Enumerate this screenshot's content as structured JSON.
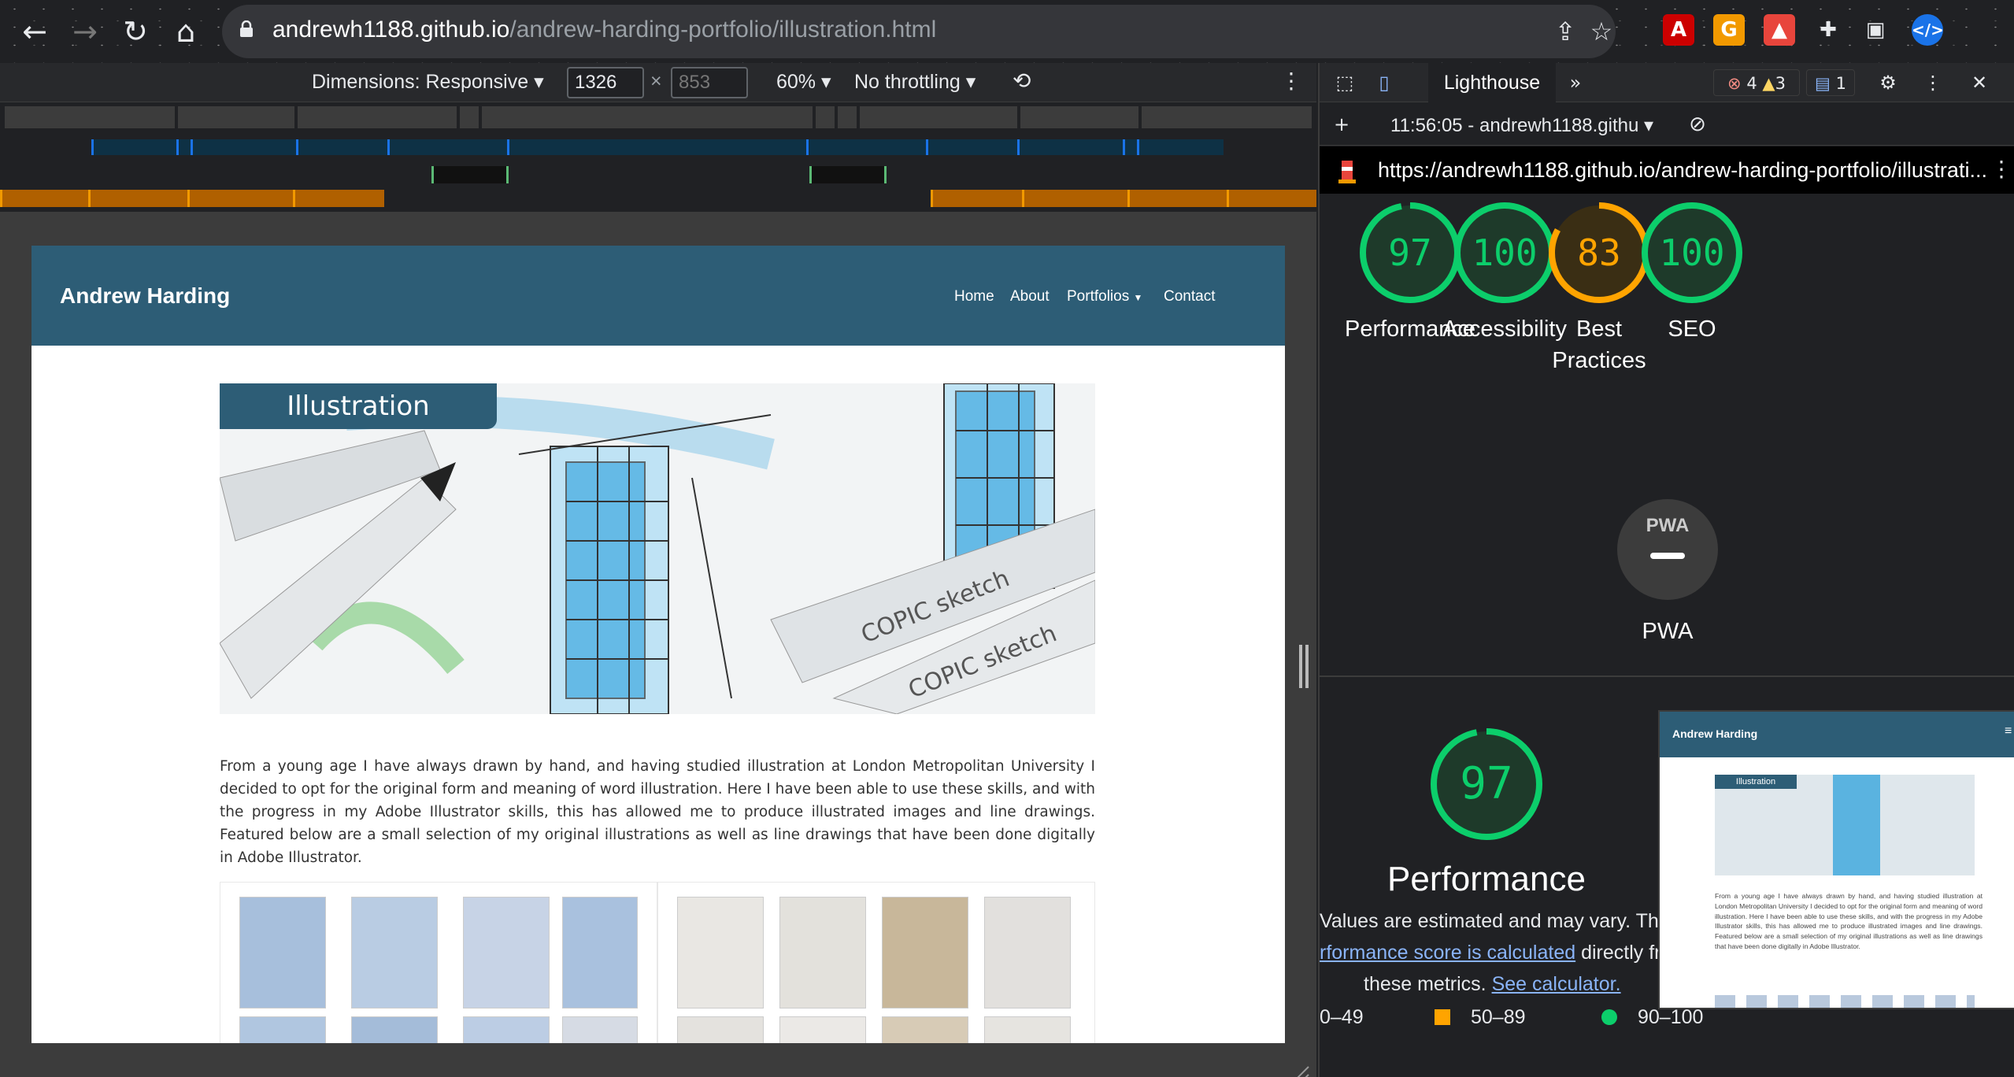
{
  "browser": {
    "url_host": "andrewh1188.github.io",
    "url_path": "/andrew-harding-portfolio/illustration.html"
  },
  "device_toolbar": {
    "dimensions": "Dimensions: Responsive",
    "width": "1326",
    "x_sep": "×",
    "height_placeholder": "853",
    "zoom": "60%",
    "throttle": "No throttling"
  },
  "site": {
    "brand": "Andrew Harding",
    "nav": [
      "Home",
      "About",
      "Portfolios",
      "Contact"
    ],
    "hero_title": "Illustration",
    "description": "From a young age I have always drawn by hand, and having studied illustration at London Metropolitan University I decided to opt for the original form and meaning of word illustration. Here I have been able to use these skills, and with the progress in my Adobe Illustrator skills, this has allowed me to produce illustrated images and line drawings. Featured below are a small selection of my original illustrations as well as line drawings that have been done digitally in Adobe Illustrator."
  },
  "devtools": {
    "active_tab": "Lighthouse",
    "errors": "4",
    "warnings": "3",
    "messages": "1",
    "report_selector": "11:56:05 - andrewh1188.githu",
    "report_url": "https://andrewh1188.github.io/andrew-harding-portfolio/illustrati...",
    "scores": [
      {
        "value": "97",
        "label": "Performance",
        "color": "#0cce6b",
        "fraction": 0.97
      },
      {
        "value": "100",
        "label": "Accessibility",
        "color": "#0cce6b",
        "fraction": 1.0
      },
      {
        "value": "83",
        "label": "Best Practices",
        "color": "#ffa400",
        "fraction": 0.83
      },
      {
        "value": "100",
        "label": "SEO",
        "color": "#0cce6b",
        "fraction": 1.0
      }
    ],
    "pwa_label": "PWA",
    "pwa_badge": "PWA",
    "perf_score": "97",
    "perf_title": "Performance",
    "perf_note_1": "Values are estimated and may vary. The",
    "perf_link_1": "rformance score is calculated",
    "perf_note_2": " directly fro",
    "perf_note_3": "these metrics.",
    "perf_link_2": "See calculator.",
    "legend": [
      "0–49",
      "50–89",
      "90–100"
    ],
    "thumb_brand": "Andrew Harding",
    "thumb_title": "Illustration",
    "thumb_text": "From a young age I have always drawn by hand, and having studied illustration at London Metropolitan University I decided to opt for the original form and meaning of word illustration. Here I have been able to use these skills, and with the progress in my Adobe Illustrator skills, this has allowed me to produce illustrated images and line drawings. Featured below are a small selection of my original illustrations as well as line drawings that have been done digitally in Adobe Illustrator."
  }
}
